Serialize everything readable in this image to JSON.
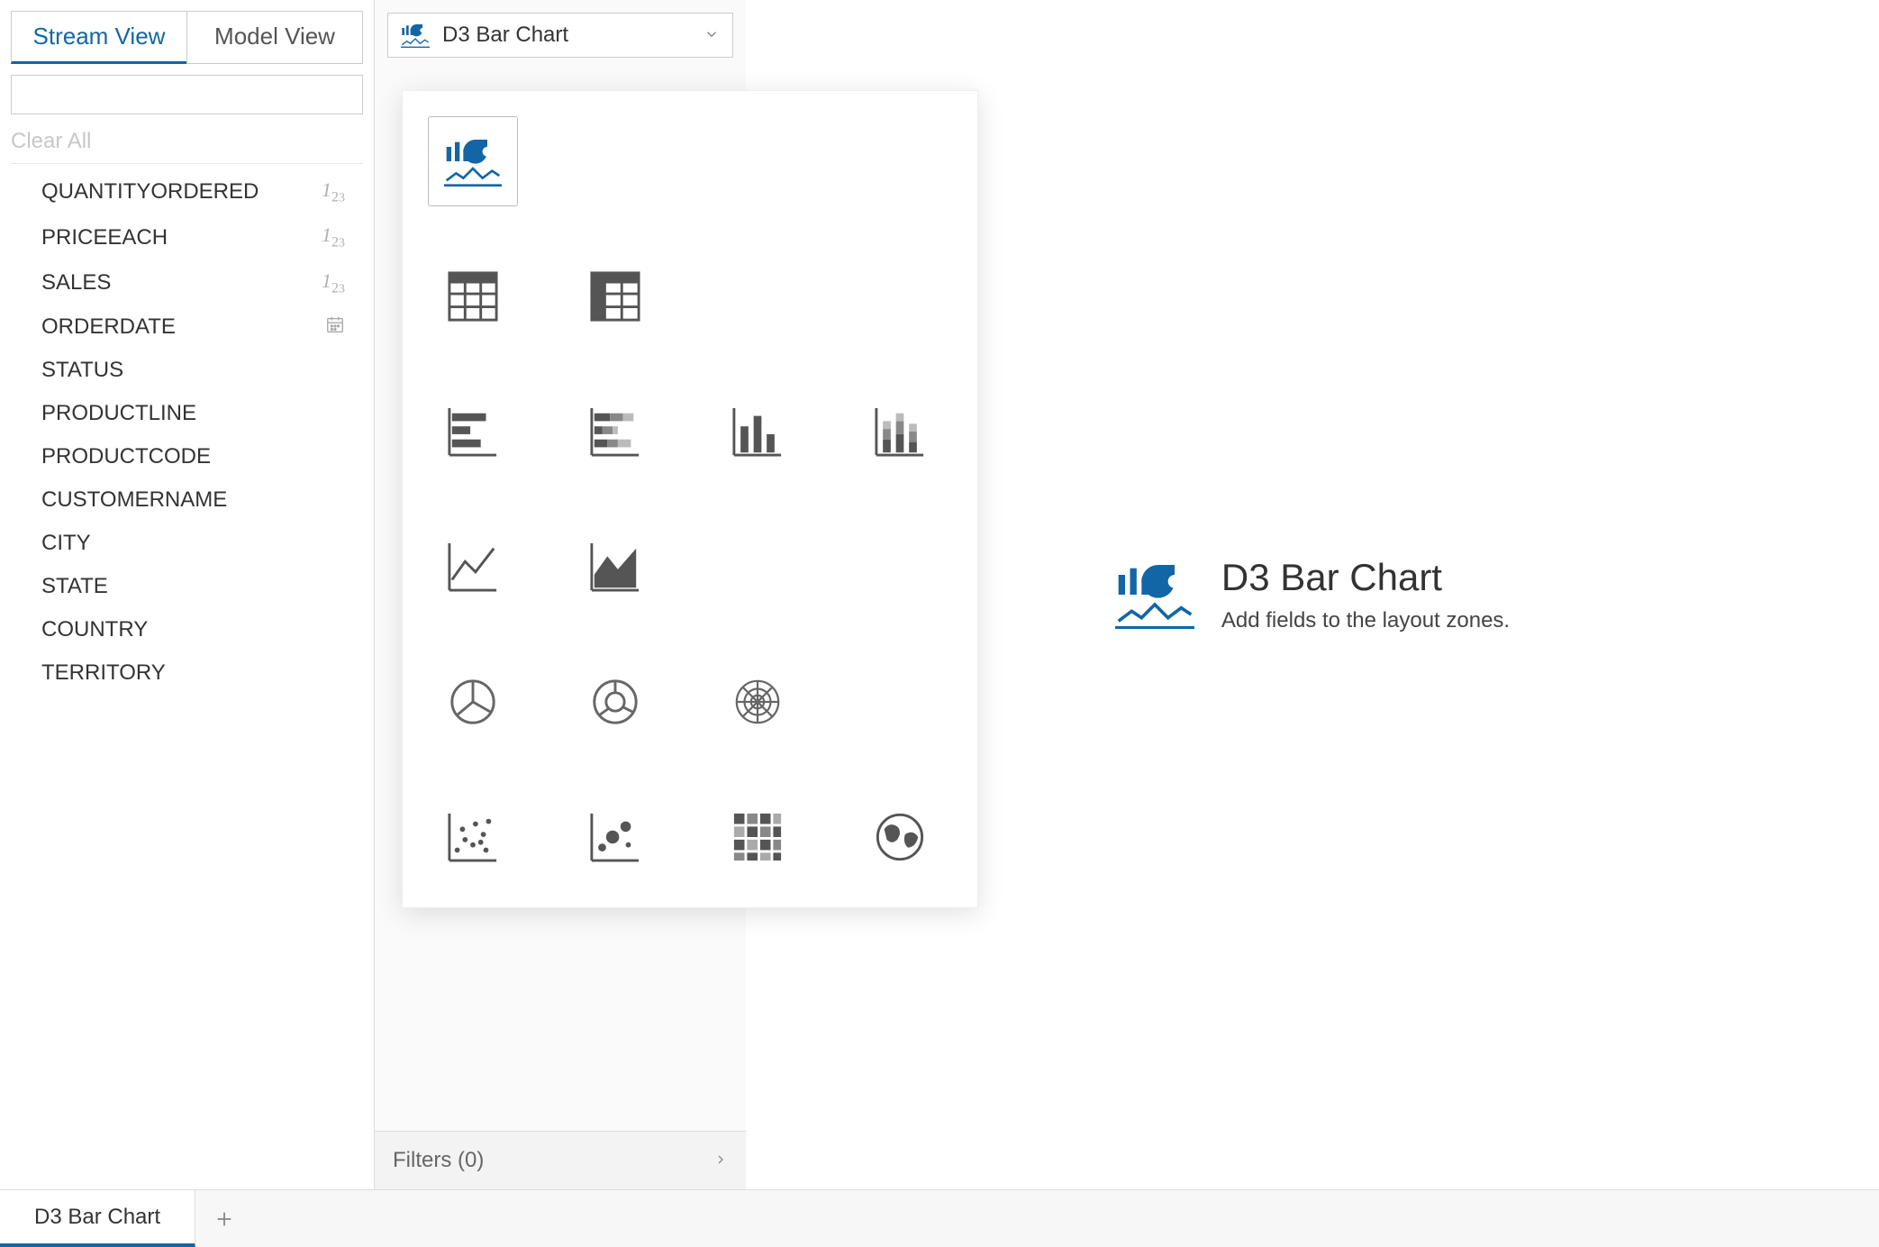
{
  "view_tabs": {
    "stream": "Stream View",
    "model": "Model View",
    "active": "stream"
  },
  "search": {
    "placeholder": ""
  },
  "clear_all": "Clear All",
  "fields": [
    {
      "label": "QUANTITYORDERED",
      "type": "number"
    },
    {
      "label": "PRICEEACH",
      "type": "number"
    },
    {
      "label": "SALES",
      "type": "number"
    },
    {
      "label": "ORDERDATE",
      "type": "date"
    },
    {
      "label": "STATUS",
      "type": ""
    },
    {
      "label": "PRODUCTLINE",
      "type": ""
    },
    {
      "label": "PRODUCTCODE",
      "type": ""
    },
    {
      "label": "CUSTOMERNAME",
      "type": ""
    },
    {
      "label": "CITY",
      "type": ""
    },
    {
      "label": "STATE",
      "type": ""
    },
    {
      "label": "COUNTRY",
      "type": ""
    },
    {
      "label": "TERRITORY",
      "type": ""
    }
  ],
  "chart_type_selector": {
    "label": "D3 Bar Chart"
  },
  "chart_options": {
    "row0": [
      "d3-combo"
    ],
    "row1": [
      "table",
      "pivot-table"
    ],
    "row2": [
      "horizontal-bar",
      "horizontal-stacked-bar",
      "vertical-bar",
      "vertical-stacked-bar"
    ],
    "row3": [
      "line",
      "area"
    ],
    "row4": [
      "pie",
      "donut",
      "sunburst"
    ],
    "row5": [
      "scatter",
      "bubble",
      "heatmap",
      "geo"
    ]
  },
  "filters": {
    "label": "Filters (0)"
  },
  "canvas": {
    "title": "D3 Bar Chart",
    "subtitle": "Add fields to the layout zones."
  },
  "bottom_tabs": {
    "items": [
      "D3 Bar Chart"
    ]
  },
  "colors": {
    "accent": "#1366a6",
    "icon_gray": "#555555"
  }
}
